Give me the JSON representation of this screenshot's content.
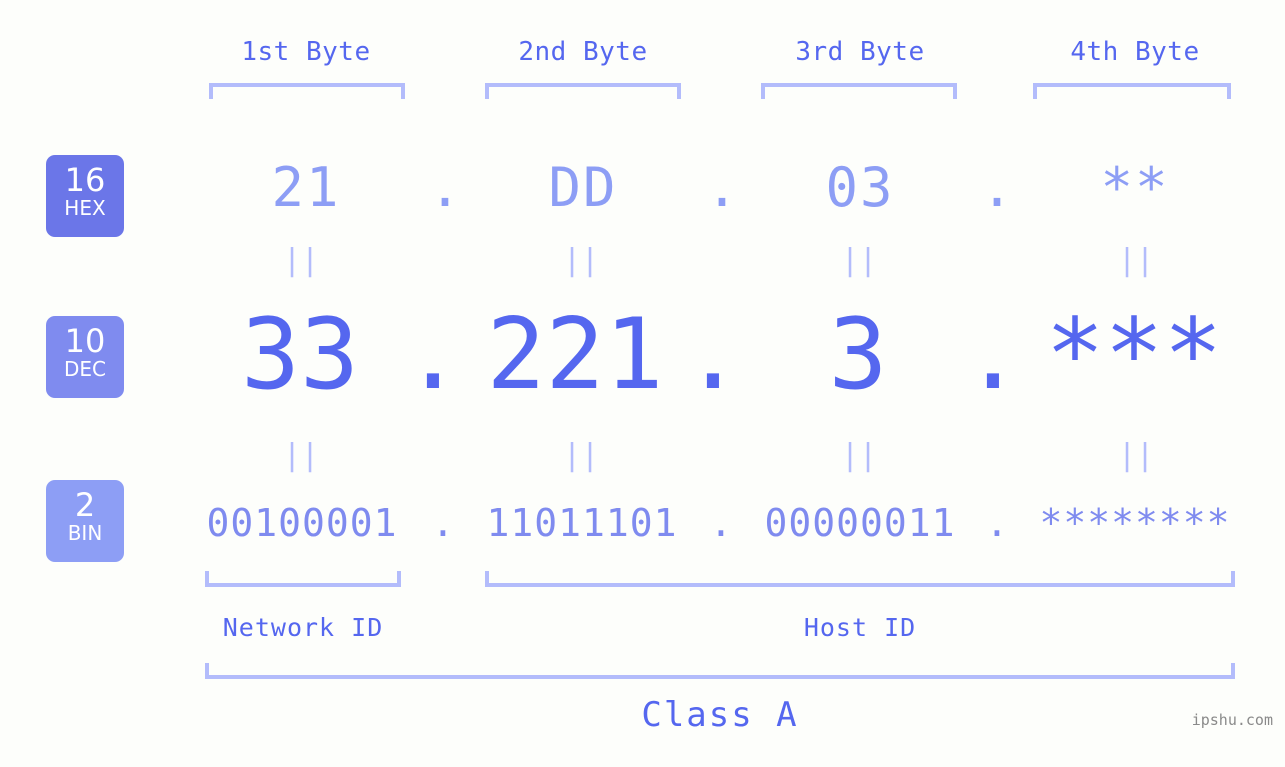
{
  "background_color": "#fdfefb",
  "accent_colors": {
    "deep_blue": "#5567ef",
    "mid_blue": "#7f8bef",
    "light_blue": "#8d9ef5",
    "pale_blue": "#b3bcfb",
    "badge_hex": "#6b76e8",
    "badge_dec": "#7f8bef",
    "badge_bin": "#8d9ef5",
    "watermark_gray": "#8a8a8a"
  },
  "byte_headers": [
    {
      "label": "1st Byte"
    },
    {
      "label": "2nd Byte"
    },
    {
      "label": "3rd Byte"
    },
    {
      "label": "4th Byte"
    }
  ],
  "bases": [
    {
      "number": "16",
      "name": "HEX"
    },
    {
      "number": "10",
      "name": "DEC"
    },
    {
      "number": "2",
      "name": "BIN"
    }
  ],
  "rows": {
    "hex": {
      "base_number": "16",
      "base_name": "HEX",
      "values": [
        "21",
        "DD",
        "03",
        "**"
      ],
      "separator": "."
    },
    "dec": {
      "base_number": "10",
      "base_name": "DEC",
      "values": [
        "33",
        "221",
        "3",
        "***"
      ],
      "separator": "."
    },
    "bin": {
      "base_number": "2",
      "base_name": "BIN",
      "values": [
        "00100001",
        "11011101",
        "00000011",
        "********"
      ],
      "separator": "."
    }
  },
  "equals_separators": {
    "glyph": "||",
    "count_per_gap": 4
  },
  "sections": [
    {
      "label": "Network ID"
    },
    {
      "label": "Host ID"
    }
  ],
  "class_label": "Class A",
  "watermark": "ipshu.com"
}
